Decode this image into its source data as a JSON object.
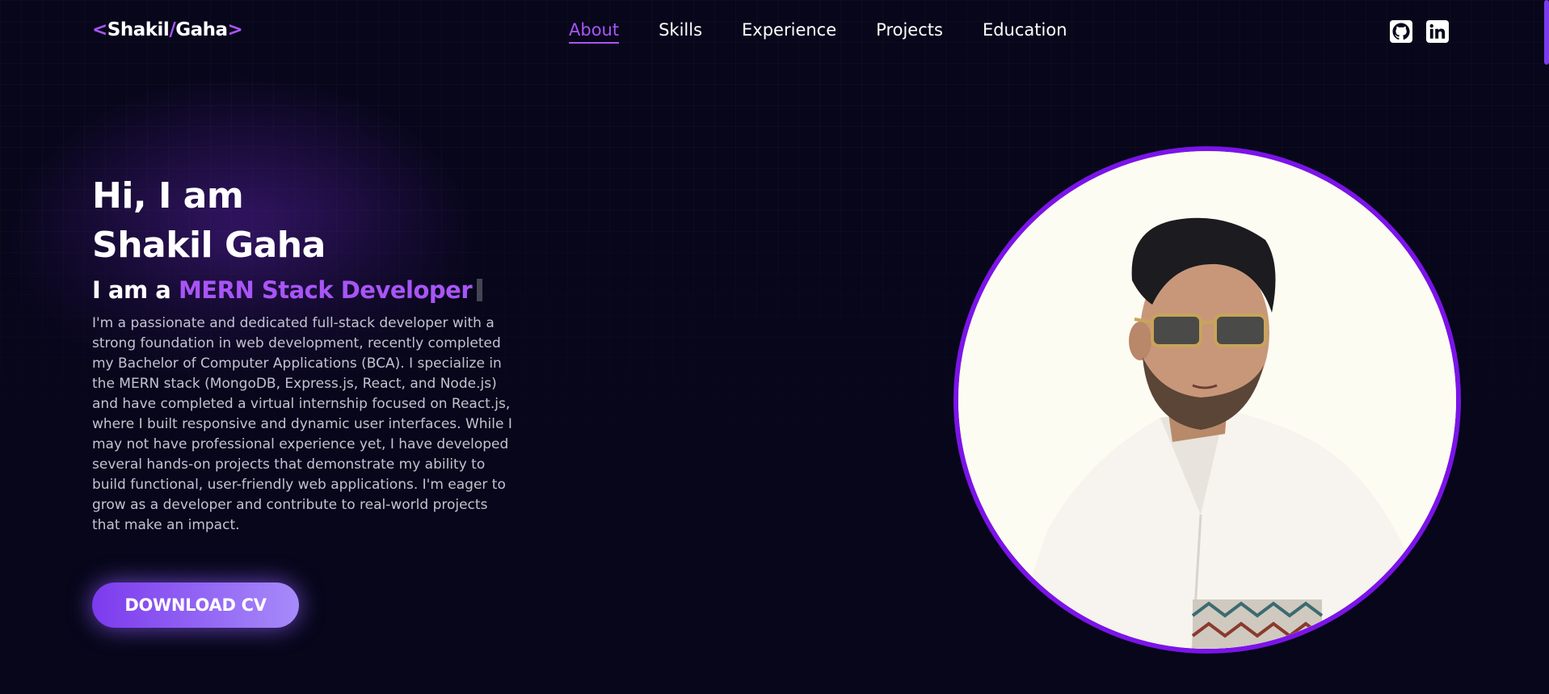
{
  "nav": {
    "logo": {
      "open": "<",
      "first": "Shakil",
      "slash": "/",
      "last": "Gaha",
      "close": ">"
    },
    "links": [
      "About",
      "Skills",
      "Experience",
      "Projects",
      "Education"
    ],
    "active": "About",
    "socials": [
      "github-icon",
      "linkedin-icon"
    ]
  },
  "hero": {
    "greeting_line1": "Hi, I am",
    "greeting_line2": "Shakil Gaha",
    "role_prefix": "I am a",
    "role": "MERN Stack Developer",
    "bio": "I'm a passionate and dedicated full-stack developer with a strong foundation in web development, recently completed my Bachelor of Computer Applications (BCA). I specialize in the MERN stack (MongoDB, Express.js, React, and Node.js) and have completed a virtual internship focused on React.js, where I built responsive and dynamic user interfaces. While I may not have professional experience yet, I have developed several hands-on projects that demonstrate my ability to build functional, user-friendly web applications. I'm eager to grow as a developer and contribute to real-world projects that make an impact.",
    "cta_label": "DOWNLOAD CV"
  },
  "colors": {
    "accent": "#a855f7",
    "background": "#07061a",
    "avatar_border": "#7b14e8"
  }
}
